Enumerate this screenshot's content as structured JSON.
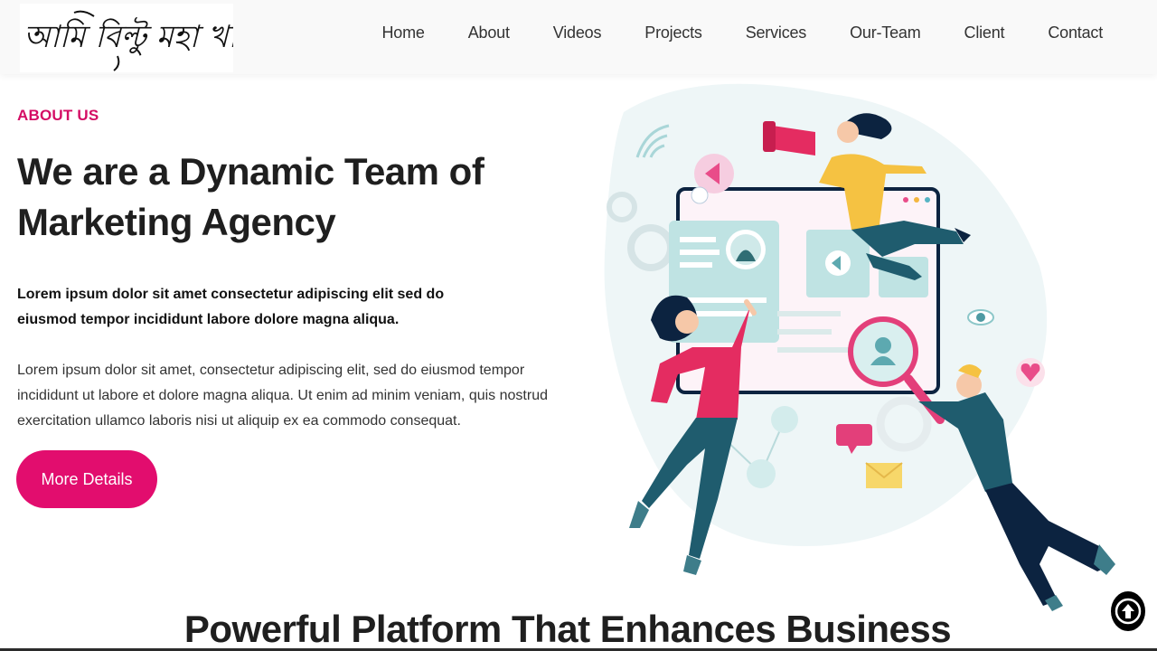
{
  "brand": {
    "logo_text": "আমি বিল্টু মহা খাদক"
  },
  "nav": {
    "items": [
      "Home",
      "About",
      "Videos",
      "Projects",
      "Services",
      "Our-Team",
      "Client",
      "Contact"
    ]
  },
  "about": {
    "eyebrow": "ABOUT US",
    "headline_line1": "We are a Dynamic Team of",
    "headline_line2": "Marketing Agency",
    "lead": "Lorem ipsum dolor sit amet consectetur adipiscing elit sed do eiusmod tempor incididunt labore dolore magna aliqua.",
    "body": "Lorem ipsum dolor sit amet, consectetur adipiscing elit, sed do eiusmod tempor incididunt ut labore et dolore magna aliqua. Ut enim ad minim veniam, quis nostrud exercitation ullamco laboris nisi ut aliquip ex ea commodo consequat.",
    "cta_label": "More Details"
  },
  "section": {
    "title": "Powerful Platform That Enhances Business"
  },
  "icons": {
    "scroll_top": "arrow-up-circle-icon",
    "illustration": "marketing-team-illustration"
  },
  "colors": {
    "accent": "#e20d6e",
    "eyebrow": "#d40d64",
    "heading": "#1f1f1f",
    "header_bg": "#f9f9f9"
  }
}
